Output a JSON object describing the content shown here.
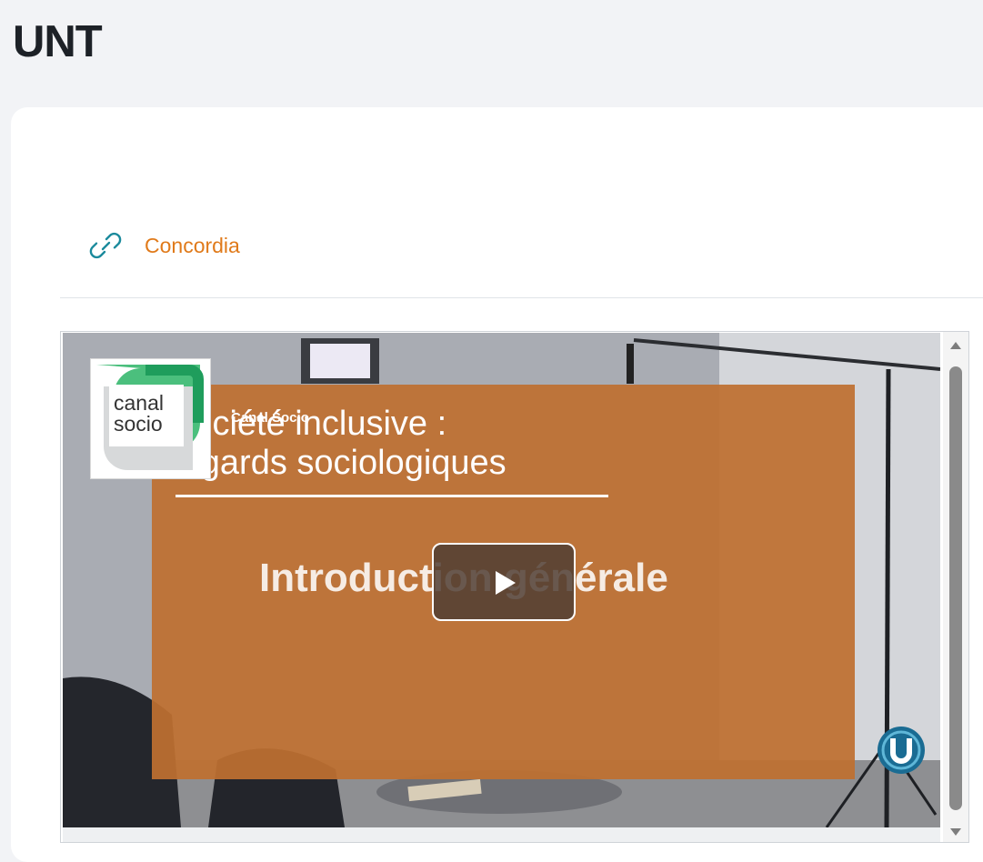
{
  "page": {
    "title": "UNT"
  },
  "resource_link": {
    "label": "Concordia",
    "icon": "link-icon",
    "color": "#e07a1a"
  },
  "video": {
    "channel_logo_text": "canal\nsocio",
    "channel_name": "Canal Socio",
    "card_title": "Société inclusive :\nregards sociologiques",
    "card_subtitle": "Introduction générale",
    "play_icon": "play-icon",
    "card_color": "#be7030",
    "university_logo_icon": "university-logo-icon"
  },
  "colors": {
    "accent_orange": "#e07a1a",
    "link_icon_teal": "#1b8a9c",
    "logo_green": "#4bbf7d"
  }
}
